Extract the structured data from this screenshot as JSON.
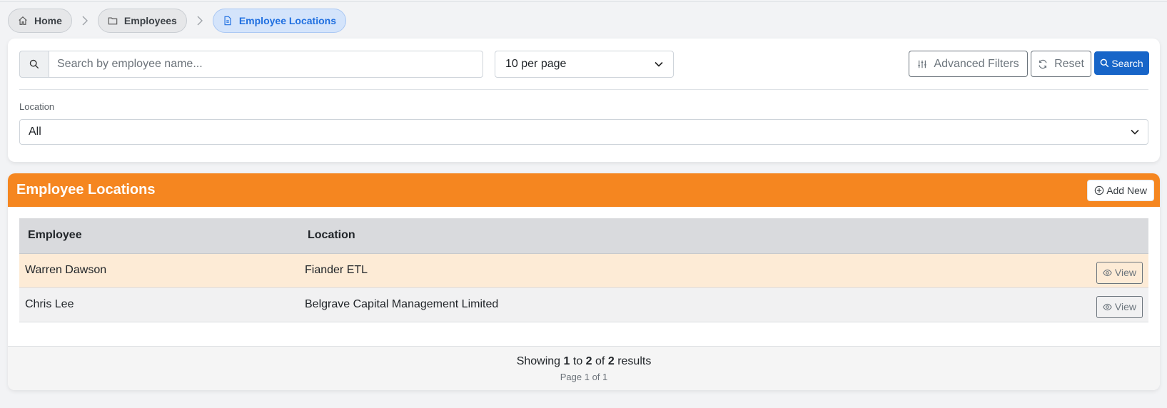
{
  "breadcrumb": {
    "items": [
      {
        "label": "Home",
        "icon": "home-icon"
      },
      {
        "label": "Employees",
        "icon": "folder-icon"
      },
      {
        "label": "Employee Locations",
        "icon": "document-icon"
      }
    ]
  },
  "filters": {
    "search_placeholder": "Search by employee name...",
    "search_value": "",
    "per_page": "10 per page",
    "advanced_filters_label": "Advanced Filters",
    "reset_label": "Reset",
    "search_label": "Search",
    "location_label": "Location",
    "location_value": "All"
  },
  "table_card": {
    "title": "Employee Locations",
    "add_new_label": "Add New",
    "header_color": "#f58620",
    "columns": [
      "Employee",
      "Location"
    ],
    "rows": [
      {
        "employee": "Warren Dawson",
        "location": "Fiander ETL",
        "action": "View"
      },
      {
        "employee": "Chris Lee",
        "location": "Belgrave Capital Management Limited",
        "action": "View"
      }
    ],
    "footer": {
      "showing_prefix": "Showing",
      "from": "1",
      "to_word": "to",
      "to": "2",
      "of_word": "of",
      "total": "2",
      "results_word": "results",
      "page_info": "Page 1 of 1"
    }
  },
  "colors": {
    "primary": "#1765c8",
    "accent": "#f58620",
    "active_crumb": "#1f6fe0"
  }
}
